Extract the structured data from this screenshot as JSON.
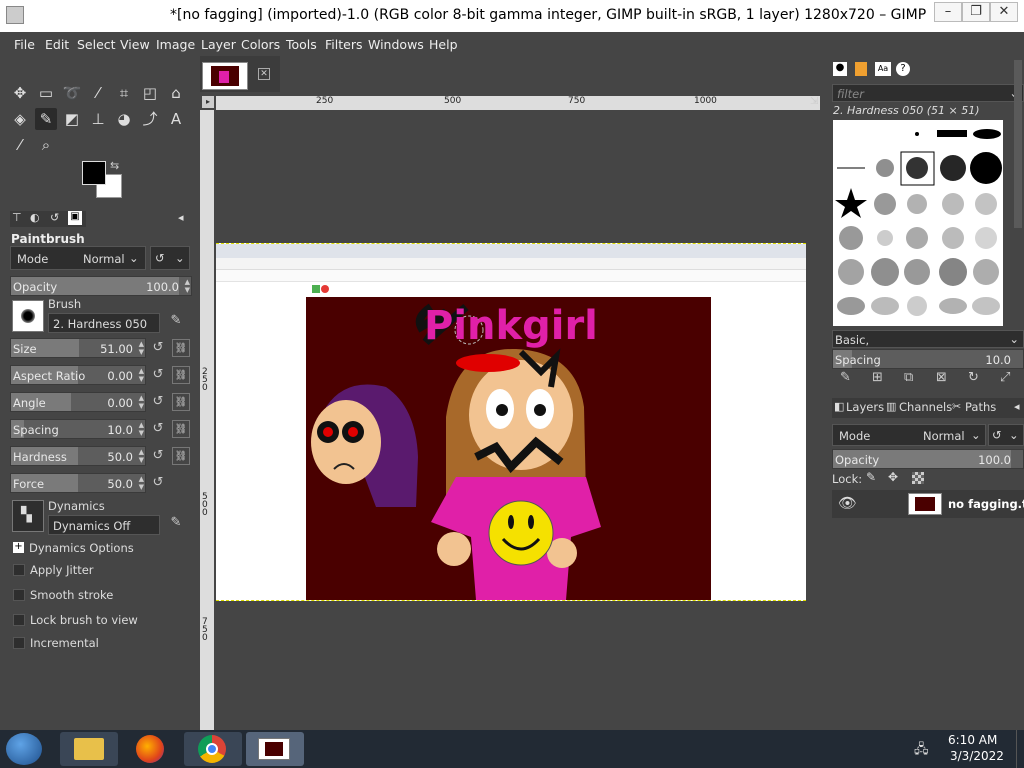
{
  "window": {
    "title": "*[no fagging] (imported)-1.0 (RGB color 8-bit gamma integer, GIMP built-in sRGB, 1 layer) 1280x720 – GIMP",
    "controls": [
      "–",
      "❐",
      "✕"
    ]
  },
  "menu": [
    "File",
    "Edit",
    "Select",
    "View",
    "Image",
    "Layer",
    "Colors",
    "Tools",
    "Filters",
    "Windows",
    "Help"
  ],
  "tool_options": {
    "tool_name": "Paintbrush",
    "mode_label": "Mode",
    "mode_value": "Normal",
    "opacity_label": "Opacity",
    "opacity_value": "100.0",
    "brush_label": "Brush",
    "brush_value": "2. Hardness 050",
    "sliders": [
      {
        "label": "Size",
        "value": "51.00",
        "fraction": 0.51
      },
      {
        "label": "Aspect Ratio",
        "value": "0.00",
        "fraction": 0.5
      },
      {
        "label": "Angle",
        "value": "0.00",
        "fraction": 0.45
      },
      {
        "label": "Spacing",
        "value": "10.0",
        "fraction": 0.1
      },
      {
        "label": "Hardness",
        "value": "50.0",
        "fraction": 0.5
      },
      {
        "label": "Force",
        "value": "50.0",
        "fraction": 0.5
      }
    ],
    "dynamics_label": "Dynamics",
    "dynamics_value": "Dynamics Off",
    "dynamics_options": "Dynamics Options",
    "checkboxes": [
      "Apply Jitter",
      "Smooth stroke",
      "Lock brush to view",
      "Incremental"
    ]
  },
  "rulers": {
    "h_ticks": [
      "250",
      "500",
      "750",
      "1000"
    ],
    "v_ticks": [
      "250",
      "500",
      "750"
    ]
  },
  "artwork": {
    "title_text": "Pinkgirl",
    "bg_color": "#4a0000",
    "pink": "#e020a8"
  },
  "right_panel": {
    "filter_placeholder": "filter",
    "brush_name": "2. Hardness 050 (51 × 51)",
    "preset": "Basic,",
    "spacing_label": "Spacing",
    "spacing_value": "10.0",
    "tabs": [
      "Layers",
      "Channels",
      "Paths"
    ],
    "mode_label": "Mode",
    "mode_value": "Normal",
    "opacity_label": "Opacity",
    "opacity_value": "100.0",
    "lock_label": "Lock:",
    "layer_name": "no fagging.tga"
  },
  "taskbar": {
    "time": "6:10 AM",
    "date": "3/3/2022"
  }
}
